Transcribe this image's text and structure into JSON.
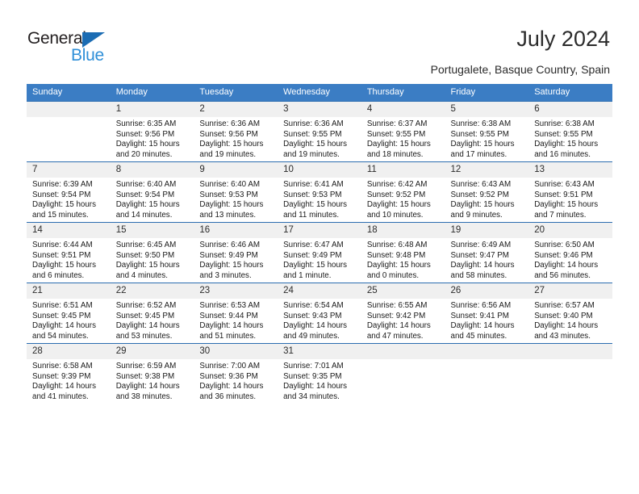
{
  "logo": {
    "word_one": "General",
    "word_two": "Blue",
    "triangle_color": "#1b6cb3",
    "word_two_color": "#2f8fd8"
  },
  "header": {
    "title": "July 2024",
    "subtitle": "Portugalete, Basque Country, Spain"
  },
  "theme": {
    "header_bg": "#3b7dc4",
    "row_border": "#2b6cb0",
    "daynum_bg": "#f0f0f0"
  },
  "calendar": {
    "weekday_headers": [
      "Sunday",
      "Monday",
      "Tuesday",
      "Wednesday",
      "Thursday",
      "Friday",
      "Saturday"
    ],
    "weeks": [
      [
        {
          "day": "",
          "empty": true,
          "sunrise": "",
          "sunset": "",
          "daylight": ""
        },
        {
          "day": "1",
          "sunrise": "Sunrise: 6:35 AM",
          "sunset": "Sunset: 9:56 PM",
          "daylight": "Daylight: 15 hours and 20 minutes."
        },
        {
          "day": "2",
          "sunrise": "Sunrise: 6:36 AM",
          "sunset": "Sunset: 9:56 PM",
          "daylight": "Daylight: 15 hours and 19 minutes."
        },
        {
          "day": "3",
          "sunrise": "Sunrise: 6:36 AM",
          "sunset": "Sunset: 9:55 PM",
          "daylight": "Daylight: 15 hours and 19 minutes."
        },
        {
          "day": "4",
          "sunrise": "Sunrise: 6:37 AM",
          "sunset": "Sunset: 9:55 PM",
          "daylight": "Daylight: 15 hours and 18 minutes."
        },
        {
          "day": "5",
          "sunrise": "Sunrise: 6:38 AM",
          "sunset": "Sunset: 9:55 PM",
          "daylight": "Daylight: 15 hours and 17 minutes."
        },
        {
          "day": "6",
          "sunrise": "Sunrise: 6:38 AM",
          "sunset": "Sunset: 9:55 PM",
          "daylight": "Daylight: 15 hours and 16 minutes."
        }
      ],
      [
        {
          "day": "7",
          "sunrise": "Sunrise: 6:39 AM",
          "sunset": "Sunset: 9:54 PM",
          "daylight": "Daylight: 15 hours and 15 minutes."
        },
        {
          "day": "8",
          "sunrise": "Sunrise: 6:40 AM",
          "sunset": "Sunset: 9:54 PM",
          "daylight": "Daylight: 15 hours and 14 minutes."
        },
        {
          "day": "9",
          "sunrise": "Sunrise: 6:40 AM",
          "sunset": "Sunset: 9:53 PM",
          "daylight": "Daylight: 15 hours and 13 minutes."
        },
        {
          "day": "10",
          "sunrise": "Sunrise: 6:41 AM",
          "sunset": "Sunset: 9:53 PM",
          "daylight": "Daylight: 15 hours and 11 minutes."
        },
        {
          "day": "11",
          "sunrise": "Sunrise: 6:42 AM",
          "sunset": "Sunset: 9:52 PM",
          "daylight": "Daylight: 15 hours and 10 minutes."
        },
        {
          "day": "12",
          "sunrise": "Sunrise: 6:43 AM",
          "sunset": "Sunset: 9:52 PM",
          "daylight": "Daylight: 15 hours and 9 minutes."
        },
        {
          "day": "13",
          "sunrise": "Sunrise: 6:43 AM",
          "sunset": "Sunset: 9:51 PM",
          "daylight": "Daylight: 15 hours and 7 minutes."
        }
      ],
      [
        {
          "day": "14",
          "sunrise": "Sunrise: 6:44 AM",
          "sunset": "Sunset: 9:51 PM",
          "daylight": "Daylight: 15 hours and 6 minutes."
        },
        {
          "day": "15",
          "sunrise": "Sunrise: 6:45 AM",
          "sunset": "Sunset: 9:50 PM",
          "daylight": "Daylight: 15 hours and 4 minutes."
        },
        {
          "day": "16",
          "sunrise": "Sunrise: 6:46 AM",
          "sunset": "Sunset: 9:49 PM",
          "daylight": "Daylight: 15 hours and 3 minutes."
        },
        {
          "day": "17",
          "sunrise": "Sunrise: 6:47 AM",
          "sunset": "Sunset: 9:49 PM",
          "daylight": "Daylight: 15 hours and 1 minute."
        },
        {
          "day": "18",
          "sunrise": "Sunrise: 6:48 AM",
          "sunset": "Sunset: 9:48 PM",
          "daylight": "Daylight: 15 hours and 0 minutes."
        },
        {
          "day": "19",
          "sunrise": "Sunrise: 6:49 AM",
          "sunset": "Sunset: 9:47 PM",
          "daylight": "Daylight: 14 hours and 58 minutes."
        },
        {
          "day": "20",
          "sunrise": "Sunrise: 6:50 AM",
          "sunset": "Sunset: 9:46 PM",
          "daylight": "Daylight: 14 hours and 56 minutes."
        }
      ],
      [
        {
          "day": "21",
          "sunrise": "Sunrise: 6:51 AM",
          "sunset": "Sunset: 9:45 PM",
          "daylight": "Daylight: 14 hours and 54 minutes."
        },
        {
          "day": "22",
          "sunrise": "Sunrise: 6:52 AM",
          "sunset": "Sunset: 9:45 PM",
          "daylight": "Daylight: 14 hours and 53 minutes."
        },
        {
          "day": "23",
          "sunrise": "Sunrise: 6:53 AM",
          "sunset": "Sunset: 9:44 PM",
          "daylight": "Daylight: 14 hours and 51 minutes."
        },
        {
          "day": "24",
          "sunrise": "Sunrise: 6:54 AM",
          "sunset": "Sunset: 9:43 PM",
          "daylight": "Daylight: 14 hours and 49 minutes."
        },
        {
          "day": "25",
          "sunrise": "Sunrise: 6:55 AM",
          "sunset": "Sunset: 9:42 PM",
          "daylight": "Daylight: 14 hours and 47 minutes."
        },
        {
          "day": "26",
          "sunrise": "Sunrise: 6:56 AM",
          "sunset": "Sunset: 9:41 PM",
          "daylight": "Daylight: 14 hours and 45 minutes."
        },
        {
          "day": "27",
          "sunrise": "Sunrise: 6:57 AM",
          "sunset": "Sunset: 9:40 PM",
          "daylight": "Daylight: 14 hours and 43 minutes."
        }
      ],
      [
        {
          "day": "28",
          "sunrise": "Sunrise: 6:58 AM",
          "sunset": "Sunset: 9:39 PM",
          "daylight": "Daylight: 14 hours and 41 minutes."
        },
        {
          "day": "29",
          "sunrise": "Sunrise: 6:59 AM",
          "sunset": "Sunset: 9:38 PM",
          "daylight": "Daylight: 14 hours and 38 minutes."
        },
        {
          "day": "30",
          "sunrise": "Sunrise: 7:00 AM",
          "sunset": "Sunset: 9:36 PM",
          "daylight": "Daylight: 14 hours and 36 minutes."
        },
        {
          "day": "31",
          "sunrise": "Sunrise: 7:01 AM",
          "sunset": "Sunset: 9:35 PM",
          "daylight": "Daylight: 14 hours and 34 minutes."
        },
        {
          "day": "",
          "empty": true,
          "sunrise": "",
          "sunset": "",
          "daylight": ""
        },
        {
          "day": "",
          "empty": true,
          "sunrise": "",
          "sunset": "",
          "daylight": ""
        },
        {
          "day": "",
          "empty": true,
          "sunrise": "",
          "sunset": "",
          "daylight": ""
        }
      ]
    ]
  }
}
